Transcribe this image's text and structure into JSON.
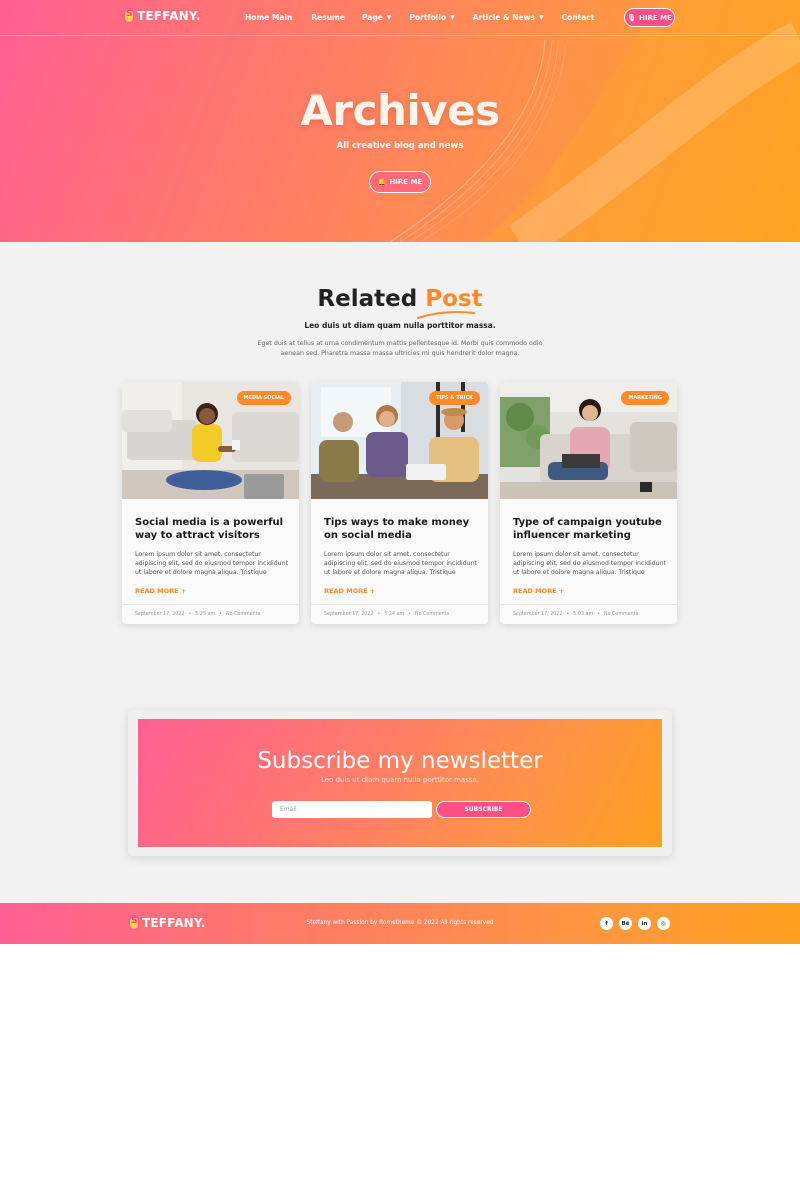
{
  "brand": {
    "logo_text": "TEFFANY.",
    "logo_glyph": "S"
  },
  "nav": {
    "items": [
      {
        "label": "Home Main",
        "dropdown": false
      },
      {
        "label": "Resume",
        "dropdown": false
      },
      {
        "label": "Page",
        "dropdown": true
      },
      {
        "label": "Portfolio",
        "dropdown": true
      },
      {
        "label": "Article & News",
        "dropdown": true
      },
      {
        "label": "Contact",
        "dropdown": false
      }
    ],
    "hire_label": "HIRE ME"
  },
  "hero": {
    "title": "Archives",
    "subtitle": "All creative blog and news",
    "button_label": "HIRE ME"
  },
  "related": {
    "title_main": "Related",
    "title_accent": "Post",
    "lead": "Leo duis ut diam quam nulla porttitor massa.",
    "description": "Eget duis at tellus at urna condimentum mattis pellentesque id. Morbi quis commodo odio aenean sed. Pharetra massa massa ultricies mi quis hendrerit dolor magna."
  },
  "posts": [
    {
      "tag": "MEDIA SOCIAL",
      "title": "Social media is a powerful way to attract visitors",
      "excerpt": "Lorem ipsum dolor sit amet, consectetur adipiscing elit, sed do eiusmod tempor incididunt ut labore et dolore magna aliqua. Tristique",
      "more": "READ MORE +",
      "date": "September 17, 2022",
      "time": "5:25 am",
      "comments": "No Comments"
    },
    {
      "tag": "TIPS & TRICK",
      "title": "Tips ways to make money on social media",
      "excerpt": "Lorem ipsum dolor sit amet, consectetur adipiscing elit, sed do eiusmod tempor incididunt ut labore et dolore magna aliqua. Tristique",
      "more": "READ MORE +",
      "date": "September 17, 2022",
      "time": "5:24 am",
      "comments": "No Comments"
    },
    {
      "tag": "MARKETING",
      "title": "Type of campaign youtube influencer marketing",
      "excerpt": "Lorem ipsum dolor sit amet, consectetur adipiscing elit, sed do eiusmod tempor incididunt ut labore et dolore magna aliqua. Tristique",
      "more": "READ MORE +",
      "date": "September 17, 2022",
      "time": "5:03 am",
      "comments": "No Comments"
    }
  ],
  "newsletter": {
    "title": "Subscribe my newsletter",
    "subtitle": "Leo duis ut diam quam nulla porttitor massa.",
    "email_placeholder": "Email",
    "button_label": "SUBSCRIBE"
  },
  "footer": {
    "logo_text": "TEFFANY.",
    "copyright": "Steffany with Passion by Rometheme © 2022 All rights reserved",
    "socials": [
      {
        "icon": "facebook-icon",
        "glyph": "f"
      },
      {
        "icon": "behance-icon",
        "glyph": "Bē"
      },
      {
        "icon": "linkedin-icon",
        "glyph": "in"
      },
      {
        "icon": "instagram-icon",
        "glyph": "◎"
      }
    ]
  },
  "colors": {
    "accent_orange": "#ff8a2a",
    "accent_pink": "#ff5f94",
    "gradient_end": "#ffa01e",
    "section_bg": "#f2f2f2"
  }
}
